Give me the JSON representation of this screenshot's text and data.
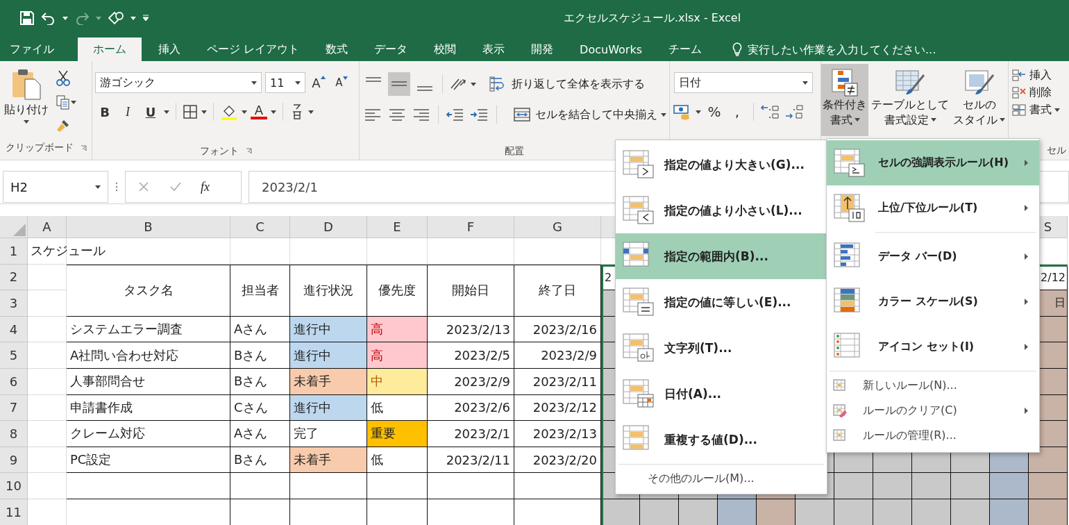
{
  "window": {
    "title": "エクセルスケジュール.xlsx - Excel"
  },
  "tabs": [
    {
      "label": "ファイル",
      "selected": false
    },
    {
      "label": "ホーム",
      "selected": true
    },
    {
      "label": "挿入",
      "selected": false
    },
    {
      "label": "ページ レイアウト",
      "selected": false
    },
    {
      "label": "数式",
      "selected": false
    },
    {
      "label": "データ",
      "selected": false
    },
    {
      "label": "校閲",
      "selected": false
    },
    {
      "label": "表示",
      "selected": false
    },
    {
      "label": "開発",
      "selected": false
    },
    {
      "label": "DocuWorks",
      "selected": false
    },
    {
      "label": "チーム",
      "selected": false
    }
  ],
  "tell_me": {
    "placeholder": "実行したい作業を入力してください..."
  },
  "ribbon": {
    "clipboard": {
      "paste": "貼り付け",
      "label": "クリップボード"
    },
    "font": {
      "name": "游ゴシック",
      "size": "11",
      "grow": "A",
      "shrink": "A",
      "bold": "B",
      "italic": "I",
      "underline": "U",
      "color_letter": "A",
      "label": "フォント"
    },
    "alignment": {
      "wrap": "折り返して全体を表示する",
      "merge": "セルを結合して中央揃え",
      "label": "配置"
    },
    "number": {
      "format": "日付",
      "percent": "%",
      "comma": ","
    },
    "styles": [
      {
        "lines": [
          "条件付き",
          "書式"
        ],
        "selected": true
      },
      {
        "lines": [
          "テーブルとして",
          "書式設定"
        ],
        "selected": false
      },
      {
        "lines": [
          "セルの",
          "スタイル"
        ],
        "selected": false
      }
    ],
    "cells": {
      "items": [
        "挿入",
        "削除",
        "書式"
      ],
      "label": "セル"
    }
  },
  "formula_bar": {
    "name_box": "H2",
    "fx": "fx",
    "value": "2023/2/1"
  },
  "sheet": {
    "columns": [
      "A",
      "B",
      "C",
      "D",
      "E",
      "F",
      "G"
    ],
    "far_column": "S",
    "rows": [
      "1",
      "2",
      "3",
      "4",
      "5",
      "6",
      "7",
      "8",
      "9",
      "10",
      "11"
    ],
    "title": "スケジュール",
    "headers": [
      "タスク名",
      "担当者",
      "進行状況",
      "優先度",
      "開始日",
      "終了日"
    ],
    "tasks": [
      {
        "task": "システムエラー調査",
        "owner": "Aさん",
        "status": {
          "text": "進行中",
          "color": "#bdd7ee"
        },
        "priority": {
          "text": "高",
          "color": "#ffc7ce"
        },
        "start": "2023/2/13",
        "end": "2023/2/16"
      },
      {
        "task": "A社問い合わせ対応",
        "owner": "Bさん",
        "status": {
          "text": "進行中",
          "color": "#bdd7ee"
        },
        "priority": {
          "text": "高",
          "color": "#ffc7ce"
        },
        "start": "2023/2/5",
        "end": "2023/2/9"
      },
      {
        "task": "人事部問合せ",
        "owner": "Bさん",
        "status": {
          "text": "未着手",
          "color": "#f8cbad"
        },
        "priority": {
          "text": "中",
          "color": "#ffeb9c"
        },
        "start": "2023/2/9",
        "end": "2023/2/11"
      },
      {
        "task": "申請書作成",
        "owner": "Cさん",
        "status": {
          "text": "進行中",
          "color": "#bdd7ee"
        },
        "priority": {
          "text": "低"
        },
        "start": "2023/2/6",
        "end": "2023/2/12"
      },
      {
        "task": "クレーム対応",
        "owner": "Aさん",
        "status": {
          "text": "完了"
        },
        "priority": {
          "text": "重要",
          "color": "#ffc000"
        },
        "start": "2023/2/1",
        "end": "2023/2/13"
      },
      {
        "task": "PC設定",
        "owner": "Bさん",
        "status": {
          "text": "未着手",
          "color": "#f8cbad"
        },
        "priority": {
          "text": "低"
        },
        "start": "2023/2/11",
        "end": "2023/2/20"
      }
    ],
    "gantt": {
      "columns": [
        {
          "color": "#c9c9c9"
        },
        {
          "color": "#c9c9c9"
        },
        {
          "color": "#c9c9c9"
        },
        {
          "color": "#acb9ca"
        },
        {
          "color": "#c9b2a6"
        },
        {
          "color": "#c9c9c9"
        },
        {
          "color": "#c9c9c9"
        },
        {
          "color": "#c9c9c9"
        },
        {
          "color": "#c9c9c9"
        },
        {
          "color": "#c9c9c9"
        },
        {
          "color": "#acb9ca"
        },
        {
          "color": "#c9b2a6"
        }
      ],
      "first_date": "2",
      "last_date": "2/12",
      "last_weekday": "日"
    }
  },
  "rules_menu": [
    {
      "label": "指定の値より大きい(G)...",
      "selected": false,
      "kind": "large"
    },
    {
      "label": "指定の値より小さい(L)...",
      "selected": false,
      "kind": "large"
    },
    {
      "label": "指定の範囲内(B)...",
      "selected": true,
      "kind": "large"
    },
    {
      "label": "指定の値に等しい(E)...",
      "selected": false,
      "kind": "large"
    },
    {
      "label": "文字列(T)...",
      "selected": false,
      "kind": "large"
    },
    {
      "label": "日付(A)...",
      "selected": false,
      "kind": "large"
    },
    {
      "label": "重複する値(D)...",
      "selected": false,
      "kind": "large"
    },
    {
      "label": "その他のルール(M)...",
      "selected": false,
      "kind": "footer"
    }
  ],
  "conditional_menu": [
    {
      "label": "セルの強調表示ルール(H)",
      "selected": true,
      "has_submenu": true,
      "kind": "large"
    },
    {
      "label": "上位/下位ルール(T)",
      "selected": false,
      "has_submenu": true,
      "kind": "large"
    },
    {
      "label": "データ バー(D)",
      "selected": false,
      "has_submenu": true,
      "kind": "large"
    },
    {
      "label": "カラー スケール(S)",
      "selected": false,
      "has_submenu": true,
      "kind": "large"
    },
    {
      "label": "アイコン セット(I)",
      "selected": false,
      "has_submenu": true,
      "kind": "large"
    },
    {
      "label": "新しいルール(N)...",
      "selected": false,
      "has_submenu": false,
      "kind": "small"
    },
    {
      "label": "ルールのクリア(C)",
      "selected": false,
      "has_submenu": true,
      "kind": "small"
    },
    {
      "label": "ルールの管理(R)...",
      "selected": false,
      "has_submenu": false,
      "kind": "small"
    }
  ]
}
